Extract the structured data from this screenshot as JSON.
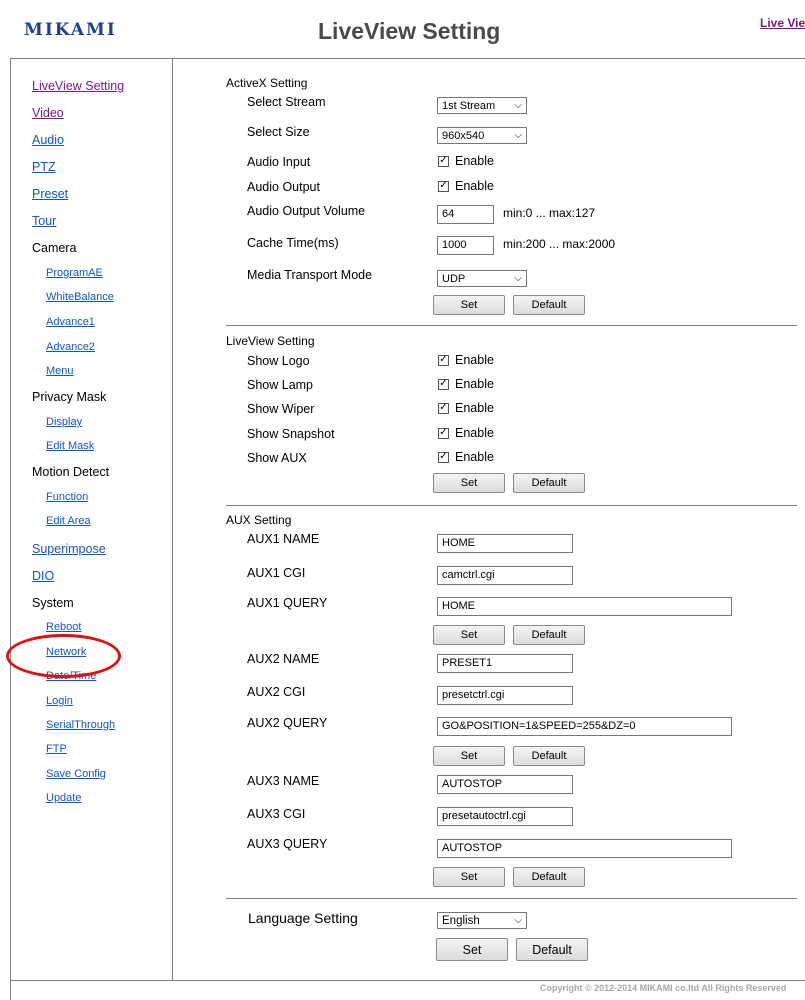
{
  "header": {
    "logo_text": "MIKAMI",
    "title": "LiveView Setting",
    "top_link": "Live View"
  },
  "sidebar": {
    "items": [
      {
        "label": "LiveView Setting"
      },
      {
        "label": "Video"
      },
      {
        "label": "Audio"
      },
      {
        "label": "PTZ"
      },
      {
        "label": "Preset"
      },
      {
        "label": "Tour"
      },
      {
        "label": "Camera"
      },
      {
        "label": "ProgramAE"
      },
      {
        "label": "WhiteBalance"
      },
      {
        "label": "Advance1"
      },
      {
        "label": "Advance2"
      },
      {
        "label": "Menu"
      },
      {
        "label": "Privacy Mask"
      },
      {
        "label": "Display"
      },
      {
        "label": "Edit Mask"
      },
      {
        "label": "Motion Detect"
      },
      {
        "label": "Function"
      },
      {
        "label": "Edit Area"
      },
      {
        "label": "Superimpose"
      },
      {
        "label": "DIO"
      },
      {
        "label": "System"
      },
      {
        "label": "Reboot"
      },
      {
        "label": "Network"
      },
      {
        "label": "Date/Time"
      },
      {
        "label": "Login"
      },
      {
        "label": "SerialThrough"
      },
      {
        "label": "FTP"
      },
      {
        "label": "Save Config"
      },
      {
        "label": "Update"
      }
    ]
  },
  "activex": {
    "title": "ActiveX Setting",
    "select_stream_label": "Select Stream",
    "select_stream_value": "1st Stream",
    "select_size_label": "Select Size",
    "select_size_value": "960x540",
    "audio_input_label": "Audio Input",
    "audio_output_label": "Audio Output",
    "enable": "Enable",
    "volume_label": "Audio Output Volume",
    "volume_value": "64",
    "volume_hint": "min:0 ... max:127",
    "cache_label": "Cache Time(ms)",
    "cache_value": "1000",
    "cache_hint": "min:200 ... max:2000",
    "transport_label": "Media Transport Mode",
    "transport_value": "UDP",
    "set": "Set",
    "default": "Default"
  },
  "liveview": {
    "title": "LiveView Setting",
    "show_logo": "Show Logo",
    "show_lamp": "Show Lamp",
    "show_wiper": "Show Wiper",
    "show_snapshot": "Show Snapshot",
    "show_aux": "Show AUX",
    "enable": "Enable",
    "set": "Set",
    "default": "Default"
  },
  "aux": {
    "title": "AUX Setting",
    "set": "Set",
    "default": "Default",
    "aux1_name_label": "AUX1 NAME",
    "aux1_name_value": "HOME",
    "aux1_cgi_label": "AUX1 CGI",
    "aux1_cgi_value": "camctrl.cgi",
    "aux1_query_label": "AUX1 QUERY",
    "aux1_query_value": "HOME",
    "aux2_name_label": "AUX2 NAME",
    "aux2_name_value": "PRESET1",
    "aux2_cgi_label": "AUX2 CGI",
    "aux2_cgi_value": "presetctrl.cgi",
    "aux2_query_label": "AUX2 QUERY",
    "aux2_query_value": "GO&POSITION=1&SPEED=255&DZ=0",
    "aux3_name_label": "AUX3 NAME",
    "aux3_name_value": "AUTOSTOP",
    "aux3_cgi_label": "AUX3 CGI",
    "aux3_cgi_value": "presetautoctrl.cgi",
    "aux3_query_label": "AUX3 QUERY",
    "aux3_query_value": "AUTOSTOP"
  },
  "language": {
    "label": "Language Setting",
    "value": "English",
    "set": "Set",
    "default": "Default"
  },
  "footer": {
    "copyright": "Copyright © 2012-2014 MIKAMI co.ltd All Rights Reserved"
  },
  "colors": {
    "link": "#1155cc",
    "visited_link": "#7a1a84",
    "logo": "#1f3f8f",
    "highlight_circle": "#e01010"
  }
}
